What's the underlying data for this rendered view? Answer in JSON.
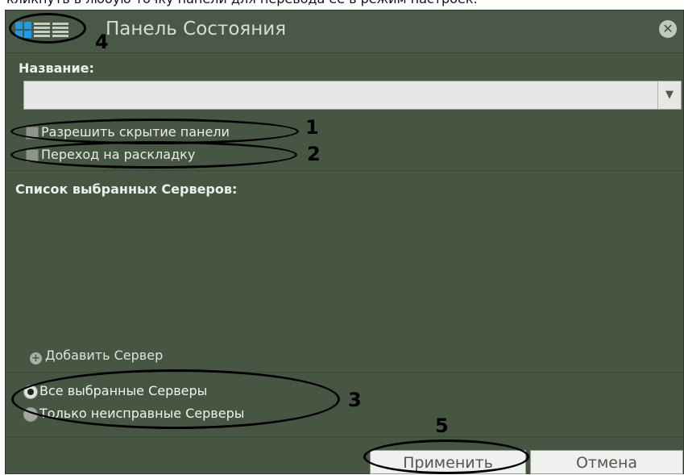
{
  "caption": "кликнуть в любую точку панели для перевода ее в режим настроек.",
  "window": {
    "title": "Панель Состояния"
  },
  "view_icons": [
    "grid-view-icon",
    "list-view-icon",
    "detail-view-icon"
  ],
  "fields": {
    "name_label": "Название:",
    "name_value": ""
  },
  "options": {
    "allow_hide": "Разрешить скрытие панели",
    "go_to_layout": "Переход на раскладку"
  },
  "servers": {
    "label": "Список выбранных Серверов:",
    "add_label": "Добавить Сервер"
  },
  "filter": {
    "all_label": "Все выбранные Серверы",
    "faulty_label": "Только неисправные Серверы",
    "selected": "all"
  },
  "buttons": {
    "apply": "Применить",
    "cancel": "Отмена"
  },
  "annotations": [
    "1",
    "2",
    "3",
    "4",
    "5"
  ],
  "colors": {
    "panel": "#475643",
    "accent": "#1e9be6",
    "annotation": "#000000"
  }
}
